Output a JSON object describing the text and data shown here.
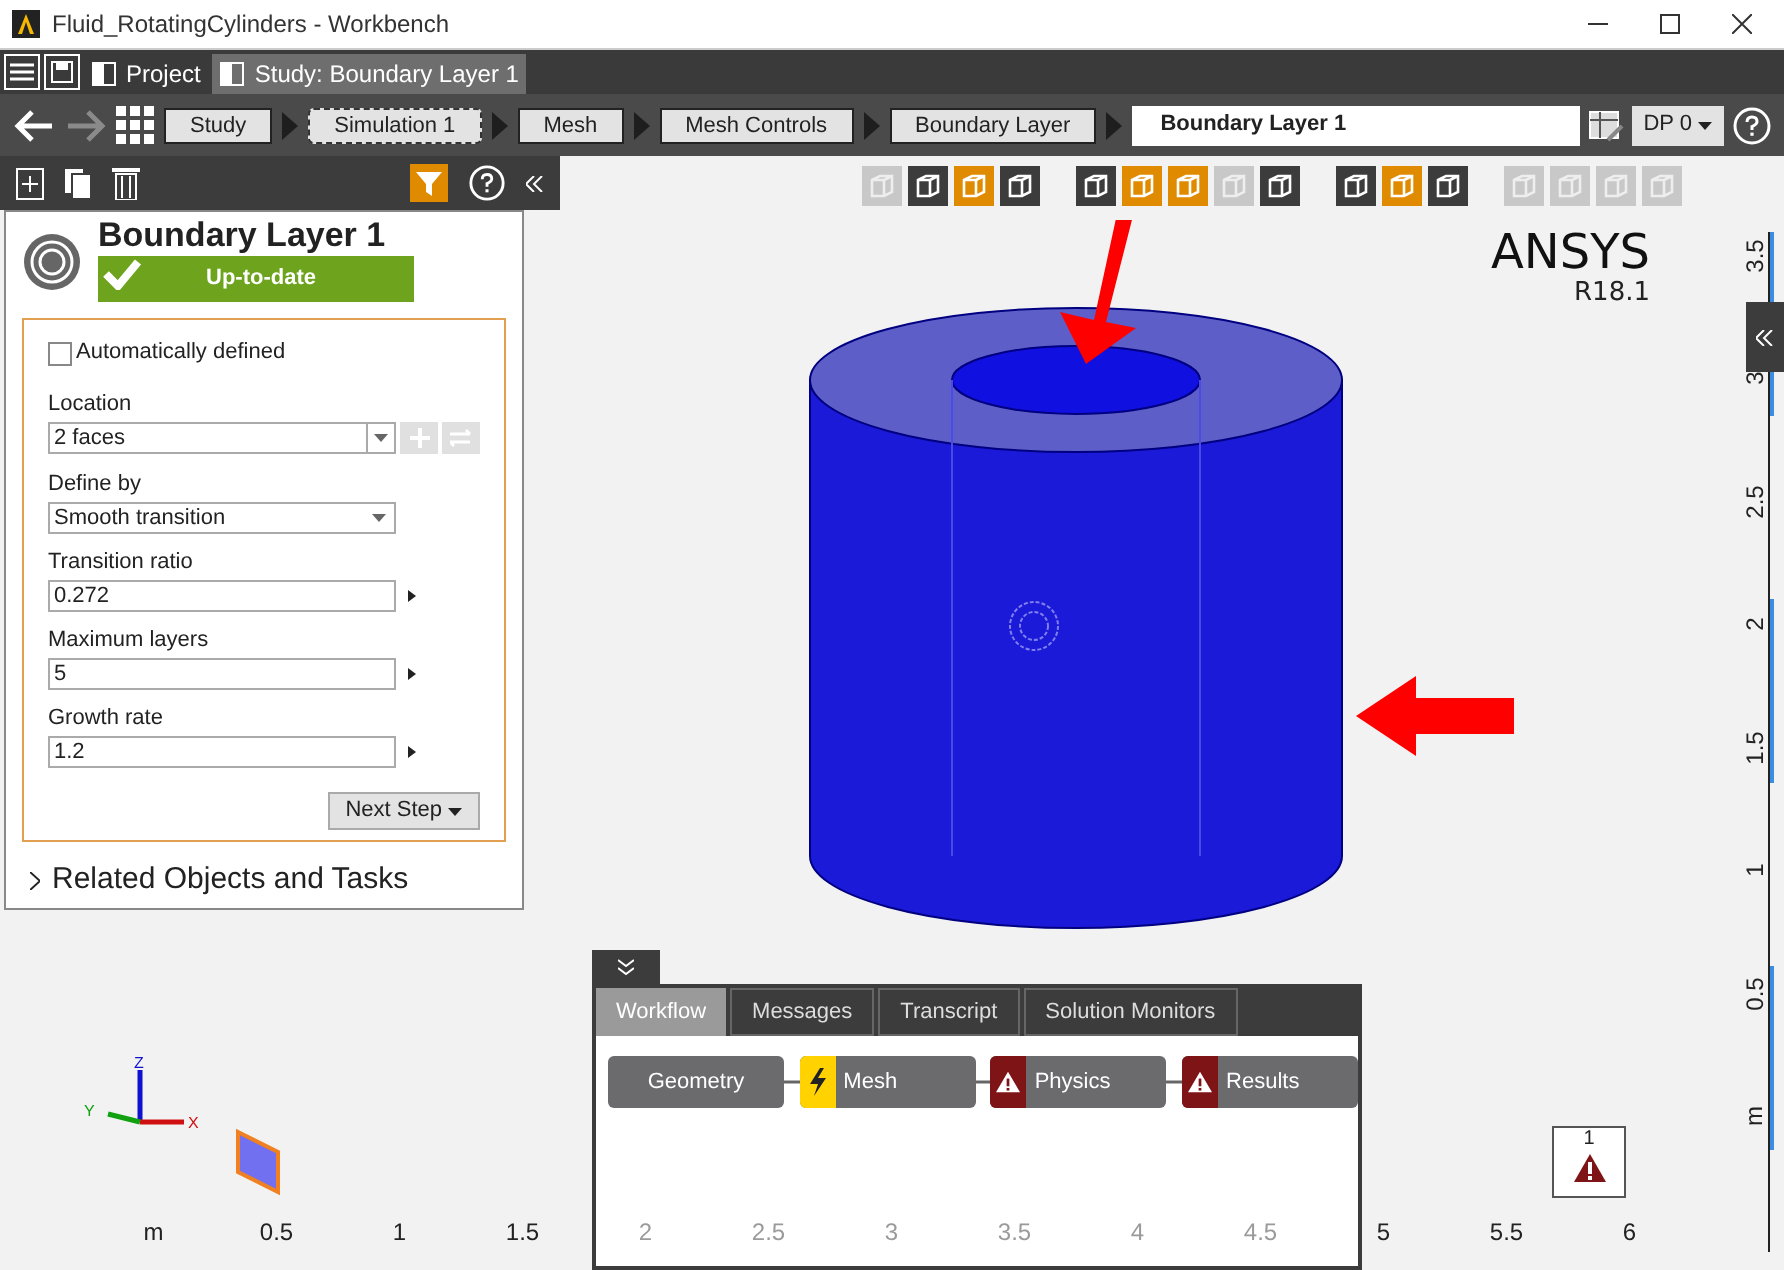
{
  "window": {
    "title": "Fluid_RotatingCylinders - Workbench"
  },
  "tabs": [
    {
      "label": "Project",
      "selected": false
    },
    {
      "label": "Study: Boundary Layer 1",
      "selected": true
    }
  ],
  "breadcrumb": [
    {
      "label": "Study",
      "kind": "button"
    },
    {
      "label": "Simulation 1",
      "kind": "dashed"
    },
    {
      "label": "Mesh",
      "kind": "button"
    },
    {
      "label": "Mesh Controls",
      "kind": "button"
    },
    {
      "label": "Boundary Layer",
      "kind": "button"
    },
    {
      "label": "Boundary Layer 1",
      "kind": "current"
    }
  ],
  "dp_menu": {
    "label": "DP 0"
  },
  "panel": {
    "title": "Boundary Layer 1",
    "status": "Up-to-date",
    "auto_defined": {
      "label": "Automatically defined",
      "checked": false
    },
    "location": {
      "label": "Location",
      "value": "2 faces"
    },
    "define_by": {
      "label": "Define by",
      "value": "Smooth transition"
    },
    "fields": [
      {
        "label": "Transition ratio",
        "value": "0.272"
      },
      {
        "label": "Maximum layers",
        "value": "5"
      },
      {
        "label": "Growth rate",
        "value": "1.2"
      }
    ],
    "next_step": "Next Step",
    "related": "Related Objects and Tasks"
  },
  "toolbar": [
    [
      {
        "active": false,
        "disabled": true
      },
      {
        "active": false,
        "disabled": false
      },
      {
        "active": true,
        "disabled": false
      },
      {
        "active": false,
        "disabled": false
      }
    ],
    [
      {
        "active": false,
        "disabled": false
      },
      {
        "active": true,
        "disabled": false
      },
      {
        "active": true,
        "disabled": false
      },
      {
        "active": false,
        "disabled": true
      },
      {
        "active": false,
        "disabled": false
      }
    ],
    [
      {
        "active": false,
        "disabled": false
      },
      {
        "active": true,
        "disabled": false
      },
      {
        "active": false,
        "disabled": false
      }
    ],
    [
      {
        "active": false,
        "disabled": true
      },
      {
        "active": false,
        "disabled": true
      },
      {
        "active": false,
        "disabled": true
      },
      {
        "active": false,
        "disabled": true
      }
    ]
  ],
  "viewport": {
    "logo": "ANSYS",
    "version": "R18.1",
    "triad": [
      "Z",
      "Y",
      "X"
    ],
    "warning_count": "1",
    "x_ruler": [
      {
        "label": "m",
        "faint": false
      },
      {
        "label": "0.5",
        "faint": false
      },
      {
        "label": "1",
        "faint": false
      },
      {
        "label": "1.5",
        "faint": false
      },
      {
        "label": "2",
        "faint": true
      },
      {
        "label": "2.5",
        "faint": true
      },
      {
        "label": "3",
        "faint": true
      },
      {
        "label": "3.5",
        "faint": true
      },
      {
        "label": "4",
        "faint": true
      },
      {
        "label": "4.5",
        "faint": true
      },
      {
        "label": "5",
        "faint": false
      },
      {
        "label": "5.5",
        "faint": false
      },
      {
        "label": "6",
        "faint": false
      }
    ],
    "y_ruler": [
      "3.5",
      "3",
      "2.5",
      "2",
      "1.5",
      "1",
      "0.5",
      "m"
    ]
  },
  "bottom_panel": {
    "tabs": [
      {
        "label": "Workflow",
        "selected": true
      },
      {
        "label": "Messages",
        "selected": false
      },
      {
        "label": "Transcript",
        "selected": false
      },
      {
        "label": "Solution Monitors",
        "selected": false
      }
    ],
    "workflow": [
      {
        "label": "Geometry",
        "kind": "plain"
      },
      {
        "label": "Mesh",
        "kind": "pending"
      },
      {
        "label": "Physics",
        "kind": "warning"
      },
      {
        "label": "Results",
        "kind": "warning"
      }
    ]
  }
}
